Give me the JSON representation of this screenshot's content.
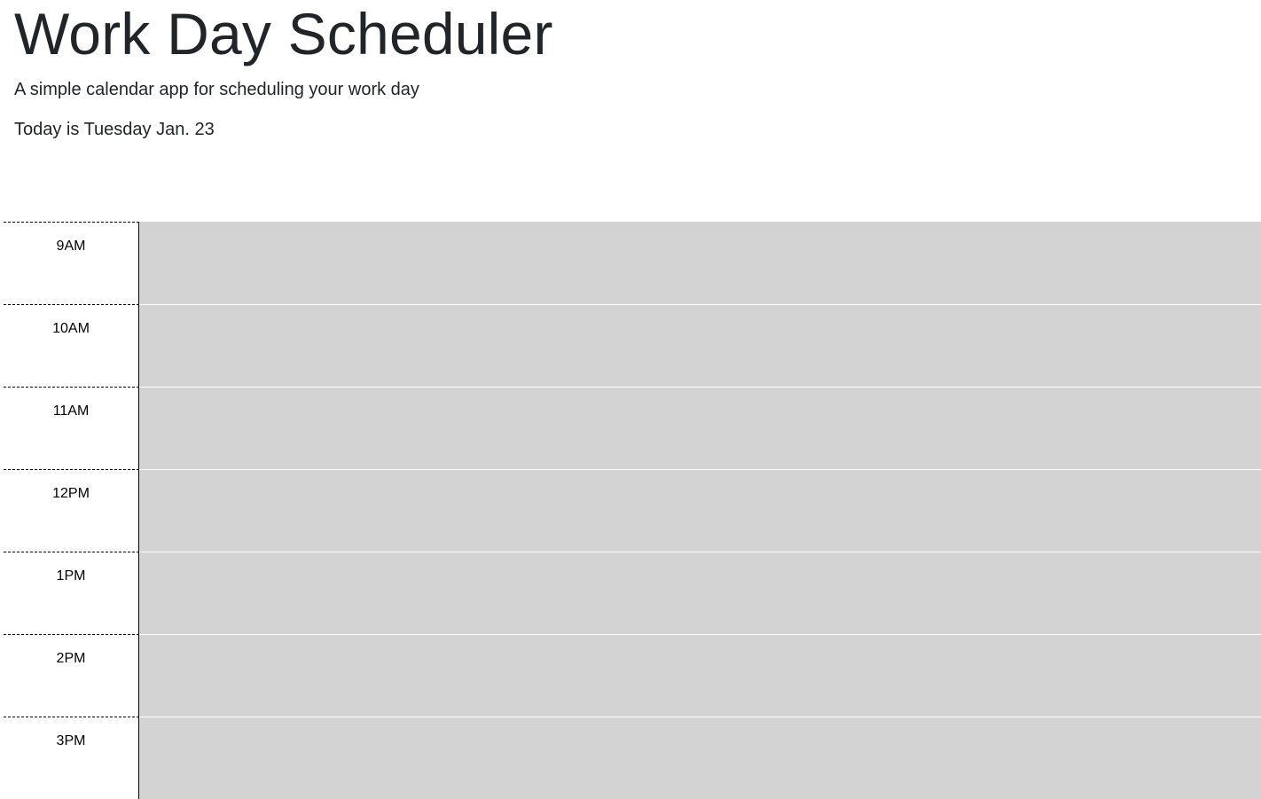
{
  "header": {
    "title": "Work Day Scheduler",
    "subtitle": "A simple calendar app for scheduling your work day",
    "current_day": "Today is Tuesday Jan. 23"
  },
  "schedule": {
    "rows": [
      {
        "hour": "9AM",
        "text": ""
      },
      {
        "hour": "10AM",
        "text": ""
      },
      {
        "hour": "11AM",
        "text": ""
      },
      {
        "hour": "12PM",
        "text": ""
      },
      {
        "hour": "1PM",
        "text": ""
      },
      {
        "hour": "2PM",
        "text": ""
      },
      {
        "hour": "3PM",
        "text": ""
      }
    ]
  },
  "colors": {
    "row_background": "#d3d3d3",
    "text": "#212529"
  }
}
